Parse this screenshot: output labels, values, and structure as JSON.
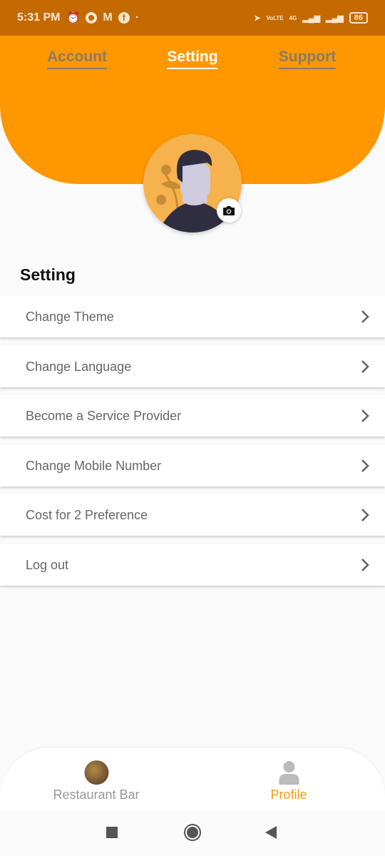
{
  "status_bar": {
    "time": "5:31 PM",
    "battery": "86",
    "network": "4G",
    "volte": "VoLTE"
  },
  "tabs": [
    {
      "label": "Account",
      "active": false
    },
    {
      "label": "Setting",
      "active": true
    },
    {
      "label": "Support",
      "active": false
    }
  ],
  "section_title": "Setting",
  "menu": [
    {
      "label": "Change Theme"
    },
    {
      "label": "Change Language"
    },
    {
      "label": "Become a Service Provider"
    },
    {
      "label": "Change Mobile Number"
    },
    {
      "label": "Cost for 2 Preference"
    },
    {
      "label": "Log out"
    }
  ],
  "bottom_nav": [
    {
      "label": "Restaurant Bar",
      "icon": "restaurant-thumbnail",
      "active": false
    },
    {
      "label": "Profile",
      "icon": "person-icon",
      "active": true
    }
  ],
  "colors": {
    "accent": "#ff9800",
    "status_bar": "#c46a00",
    "active_nav": "#f39c12"
  }
}
